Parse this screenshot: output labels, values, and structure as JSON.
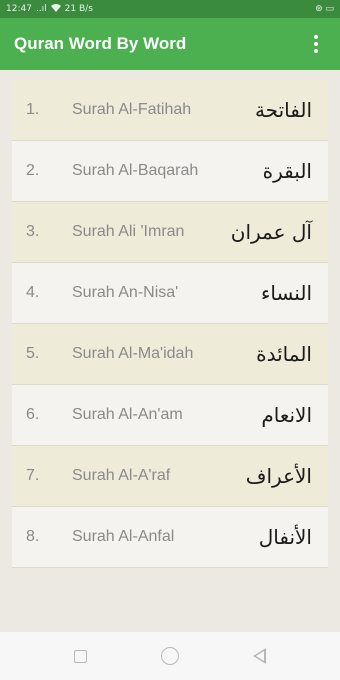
{
  "status_bar": {
    "time": "12:47",
    "signal": "..ıl",
    "network_speed": "21 B/s",
    "right_icons": "⊛ ▭"
  },
  "app": {
    "title": "Quran Word By Word"
  },
  "surahs": [
    {
      "number": "1.",
      "name": "Surah Al-Fatihah",
      "arabic": "الفاتحة"
    },
    {
      "number": "2.",
      "name": "Surah Al-Baqarah",
      "arabic": "البقرة"
    },
    {
      "number": "3.",
      "name": "Surah Ali 'Imran",
      "arabic": "آل عمران"
    },
    {
      "number": "4.",
      "name": "Surah An-Nisa'",
      "arabic": "النساء"
    },
    {
      "number": "5.",
      "name": "Surah Al-Ma'idah",
      "arabic": "المائدة"
    },
    {
      "number": "6.",
      "name": "Surah Al-An'am",
      "arabic": "الانعام"
    },
    {
      "number": "7.",
      "name": "Surah Al-A'raf",
      "arabic": "الأعراف"
    },
    {
      "number": "8.",
      "name": "Surah Al-Anfal",
      "arabic": "الأنفال"
    }
  ],
  "colors": {
    "app_bar": "#4caf50",
    "status_bar": "#3a8b3e",
    "row_odd": "#efebd9",
    "row_even": "#f5f3ef"
  }
}
